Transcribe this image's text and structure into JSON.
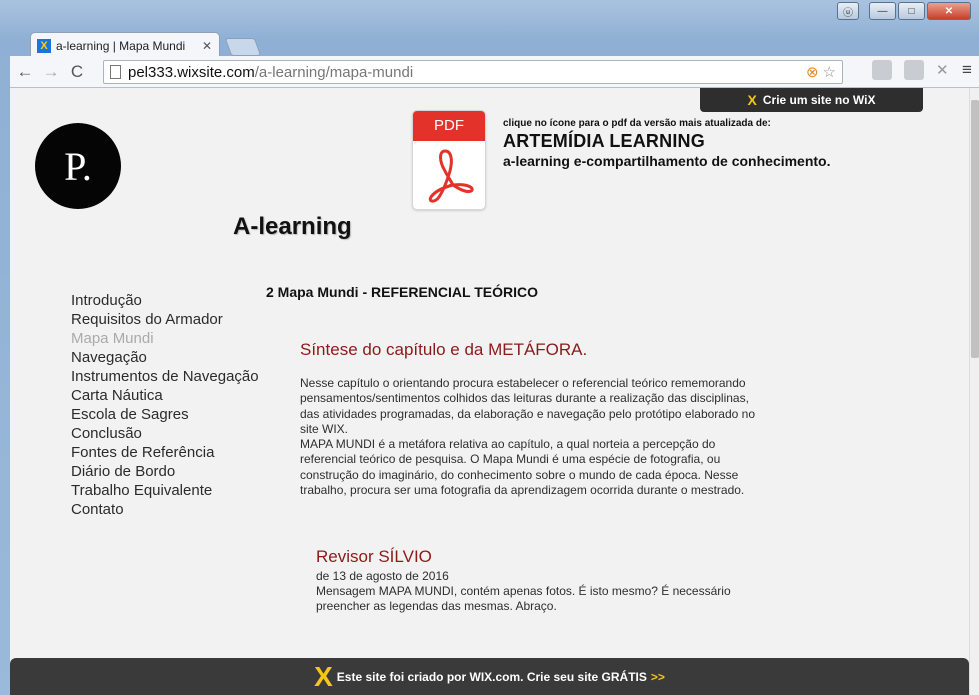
{
  "window": {
    "controls": {
      "user": "ⓤ",
      "minimize": "—",
      "maximize": "□",
      "close": "✕"
    }
  },
  "browser": {
    "tab": {
      "title": "a-learning | Mapa Mundi",
      "close": "✕",
      "favicon": "X"
    },
    "nav": {
      "back": "←",
      "forward": "→",
      "reload": "C"
    },
    "url": {
      "host": "pel333.wixsite.com",
      "path": "/a-learning/mapa-mundi"
    },
    "icons": [
      "cookie-blocked-icon",
      "star-icon",
      "extension-icon",
      "extension-icon",
      "x-extension-icon",
      "menu-icon"
    ],
    "menu": "≡",
    "star": "☆",
    "cookie": "🍪"
  },
  "page": {
    "wix_badge": {
      "x": "X",
      "text": "Crie um site no WiX"
    },
    "logo": "P.",
    "pdf": {
      "label": "PDF"
    },
    "pdf_caption": "clique no ícone para o pdf da versão mais atualizada de:",
    "brand_title": "ARTEMÍDIA LEARNING",
    "brand_sub": "a-learning e-compartilhamento de conhecimento.",
    "site_title": "A-learning",
    "nav": [
      {
        "label": "Introdução",
        "active": false
      },
      {
        "label": "Requisitos do Armador",
        "active": false
      },
      {
        "label": "Mapa Mundi",
        "active": true
      },
      {
        "label": "Navegação",
        "active": false
      },
      {
        "label": "Instrumentos de Navegação",
        "active": false
      },
      {
        "label": "Carta Náutica",
        "active": false
      },
      {
        "label": "Escola de Sagres",
        "active": false
      },
      {
        "label": "Conclusão",
        "active": false
      },
      {
        "label": "Fontes de Referência",
        "active": false
      },
      {
        "label": "Diário de Bordo",
        "active": false
      },
      {
        "label": "Trabalho Equivalente",
        "active": false
      },
      {
        "label": "Contato",
        "active": false
      }
    ],
    "section_heading": "2 Mapa Mundi - REFERENCIAL TEÓRICO",
    "synthesis_heading": "Síntese do capítulo e da METÁFORA.",
    "body_lines": [
      "Nesse capítulo o orientando procura estabelecer o referencial teórico rememorando",
      "pensamentos/sentimentos colhidos das leituras durante a realização das disciplinas,",
      "das atividades programadas, da elaboração e navegação pelo protótipo elaborado no",
      "site WIX.",
      "MAPA MUNDI é a metáfora relativa ao capítulo, a qual norteia a percepção do",
      "referencial teórico de pesquisa. O Mapa Mundi é uma espécie de fotografia, ou",
      "construção do imaginário, do conhecimento sobre o mundo de cada época. Nesse",
      "trabalho, procura ser uma fotografia da aprendizagem ocorrida durante o mestrado."
    ],
    "comment": {
      "author": "Revisor SÍLVIO",
      "date": "de 13 de agosto de 2016",
      "lines": [
        "Mensagem MAPA MUNDI, contém apenas fotos. É isto mesmo? É necessário",
        "preencher as legendas das mesmas. Abraço."
      ]
    },
    "footer": {
      "x": "X",
      "text": "Este site foi criado por WIX.com. Crie seu site GRÁTIS",
      "arrows": ">>"
    }
  }
}
